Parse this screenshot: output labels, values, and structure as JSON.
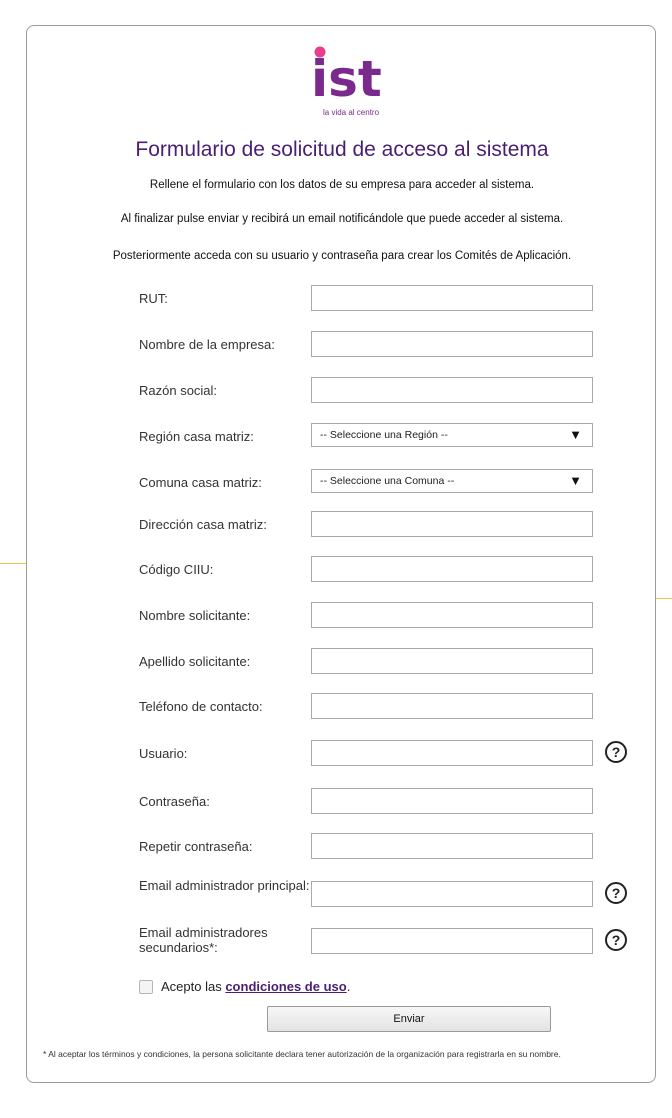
{
  "brand": {
    "logo_text": "ist",
    "tagline": "la vida al centro",
    "color": "#7a2a8d",
    "dot_color": "#e83e8c"
  },
  "header": {
    "title": "Formulario de solicitud de acceso al sistema",
    "intro": [
      "Rellene el formulario con los datos de su empresa para acceder al sistema.",
      "Al finalizar pulse enviar y recibirá un email notificándole que puede acceder al sistema.",
      "Posteriormente acceda con su usuario y contraseña para crear los Comités de Aplicación."
    ]
  },
  "form": {
    "fields": [
      {
        "label": "RUT:",
        "value": ""
      },
      {
        "label": "Nombre de la empresa:",
        "value": ""
      },
      {
        "label": "Razón social:",
        "value": ""
      },
      {
        "label": "Región casa matriz:",
        "selected": "-- Seleccione una Región --"
      },
      {
        "label": "Comuna casa matriz:",
        "selected": "-- Seleccione una Comuna --"
      },
      {
        "label": "Dirección casa matriz:",
        "value": ""
      },
      {
        "label": "Código CIIU:",
        "value": ""
      },
      {
        "label": "Nombre solicitante:",
        "value": ""
      },
      {
        "label": "Apellido solicitante:",
        "value": ""
      },
      {
        "label": "Teléfono de contacto:",
        "value": ""
      },
      {
        "label": "Usuario:",
        "value": ""
      },
      {
        "label": "Contraseña:",
        "value": ""
      },
      {
        "label": "Repetir contraseña:",
        "value": ""
      },
      {
        "label": "Email administrador principal:",
        "value": ""
      },
      {
        "label": "Email administradores secundarios*:",
        "value": ""
      }
    ],
    "help_symbol": "?",
    "terms_prefix": "Acepto las",
    "terms_link": "condiciones de uso",
    "terms_suffix": ".",
    "submit_label": "Enviar",
    "footnote": "* Al aceptar los términos y condiciones, la persona solicitante declara tener autorización de la organización para registrarla en su nombre."
  }
}
